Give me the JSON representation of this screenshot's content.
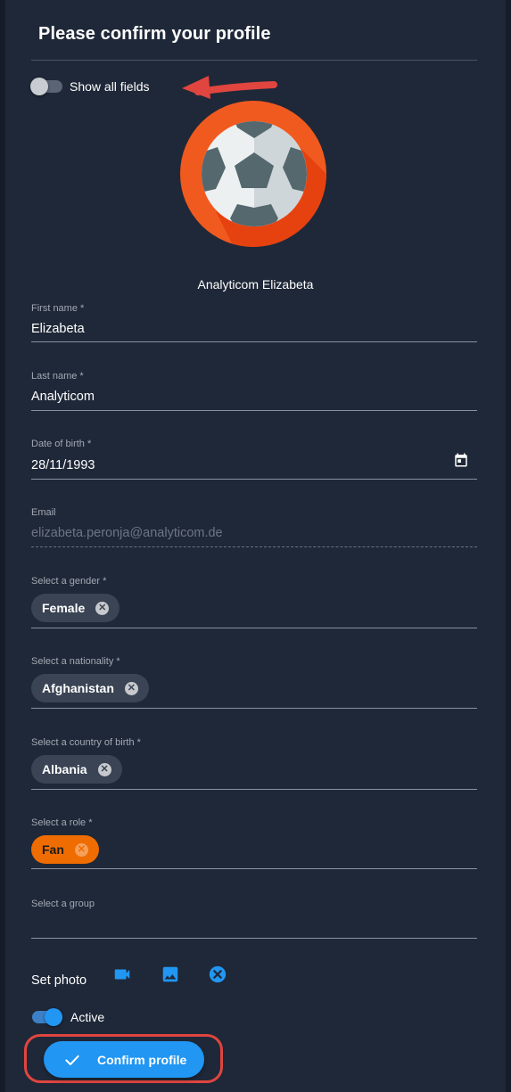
{
  "header": {
    "title": "Please confirm your profile"
  },
  "show_all_fields": {
    "label": "Show all fields",
    "checked": false
  },
  "profile": {
    "display_name": "Analyticom Elizabeta",
    "avatar_icon": "soccer-ball-icon"
  },
  "fields": {
    "first_name": {
      "label": "First name *",
      "value": "Elizabeta"
    },
    "last_name": {
      "label": "Last name *",
      "value": "Analyticom"
    },
    "date_of_birth": {
      "label": "Date of birth *",
      "value": "28/11/1993",
      "icon": "calendar-icon"
    },
    "email": {
      "label": "Email",
      "value": "elizabeta.peronja@analyticom.de"
    },
    "gender": {
      "label": "Select a gender *",
      "chip": "Female"
    },
    "nationality": {
      "label": "Select a nationality *",
      "chip": "Afghanistan"
    },
    "country_of_birth": {
      "label": "Select a country of birth *",
      "chip": "Albania"
    },
    "role": {
      "label": "Select a role *",
      "chip": "Fan"
    },
    "group": {
      "label": "Select a group"
    }
  },
  "photo": {
    "label": "Set photo",
    "icons": [
      "video-camera-icon",
      "image-icon",
      "clear-icon"
    ]
  },
  "active": {
    "label": "Active",
    "checked": true
  },
  "confirm": {
    "label": "Confirm profile",
    "icon": "check-icon"
  },
  "colors": {
    "background": "#1f2838",
    "accent": "#2196f3",
    "role_chip": "#ef6c00",
    "annotation": "#e0453f"
  }
}
